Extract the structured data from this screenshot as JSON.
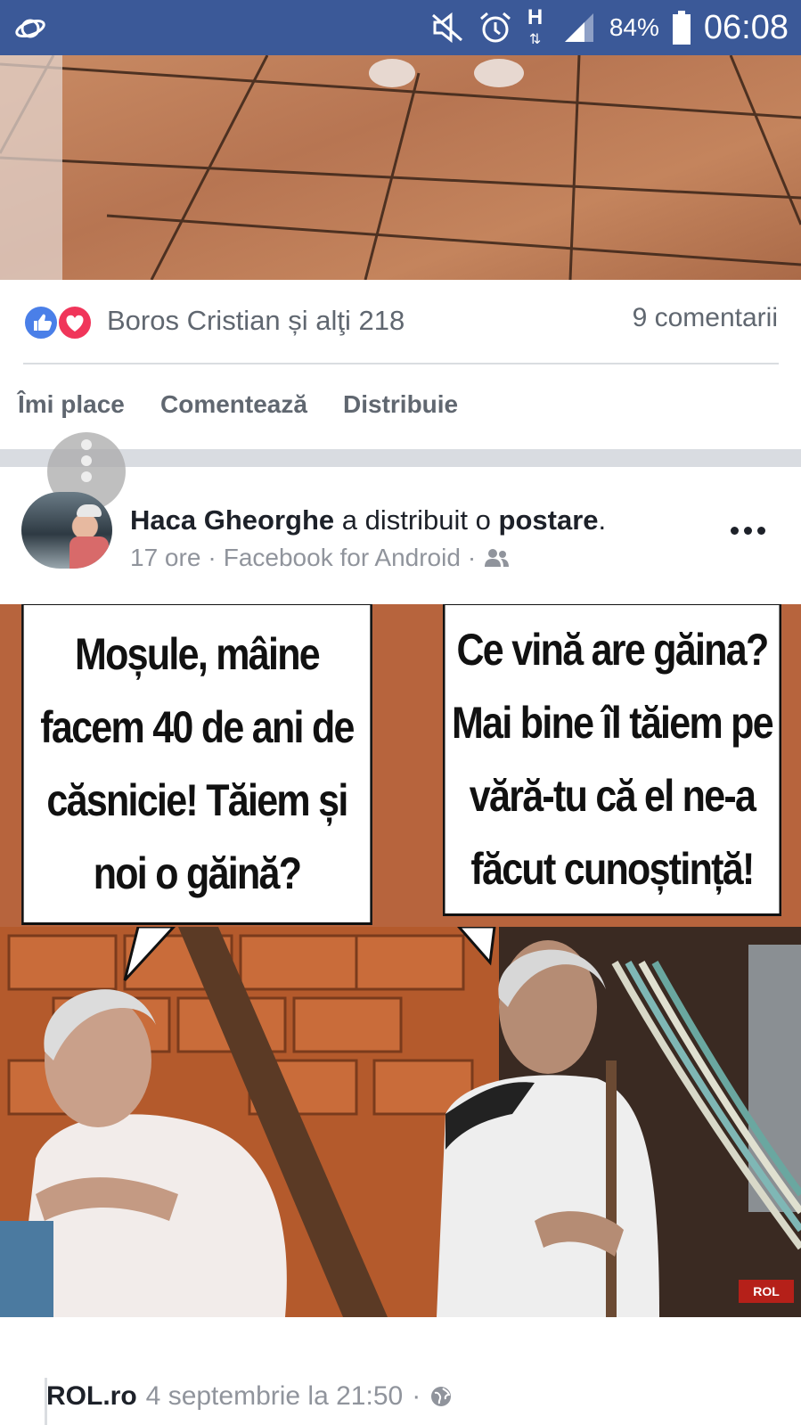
{
  "statusbar": {
    "battery": "84%",
    "time": "06:08",
    "network_type": "H",
    "icons": [
      "saturn-icon",
      "mute-icon",
      "alarm-icon",
      "network-arrows-icon",
      "signal-icon",
      "battery-icon"
    ]
  },
  "prev_post": {
    "reactions": {
      "names": "Boros Cristian și alţi 218",
      "icons": [
        "like-icon",
        "love-icon"
      ]
    },
    "comments": "9 comentarii",
    "actions": {
      "like": "Îmi place",
      "comment": "Comentează",
      "share": "Distribuie"
    }
  },
  "post": {
    "author": "Haca Gheorghe",
    "action_text": "a distribuit o",
    "object": "postare",
    "punct": ".",
    "time": "17 ore",
    "source": "Facebook for Android",
    "sep": "·",
    "audience_icon": "friends-icon",
    "meme": {
      "left_bubble": "Moșule, mâine facem 40 de ani de căsnicie! Tăiem și noi o găină?",
      "right_bubble": "Ce vină are găina? Mai bine îl tăiem pe vără-tu că el ne-a făcut cunoștință!",
      "watermark": "ROL"
    }
  },
  "shared": {
    "page": "ROL.ro",
    "date": "4 septembrie la 21:50",
    "sep": "·",
    "audience_icon": "globe-icon"
  },
  "colors": {
    "facebook_blue": "#3b5998",
    "like_blue": "#4a7fe8",
    "love_red": "#f0355a",
    "secondary_text": "#606770"
  }
}
